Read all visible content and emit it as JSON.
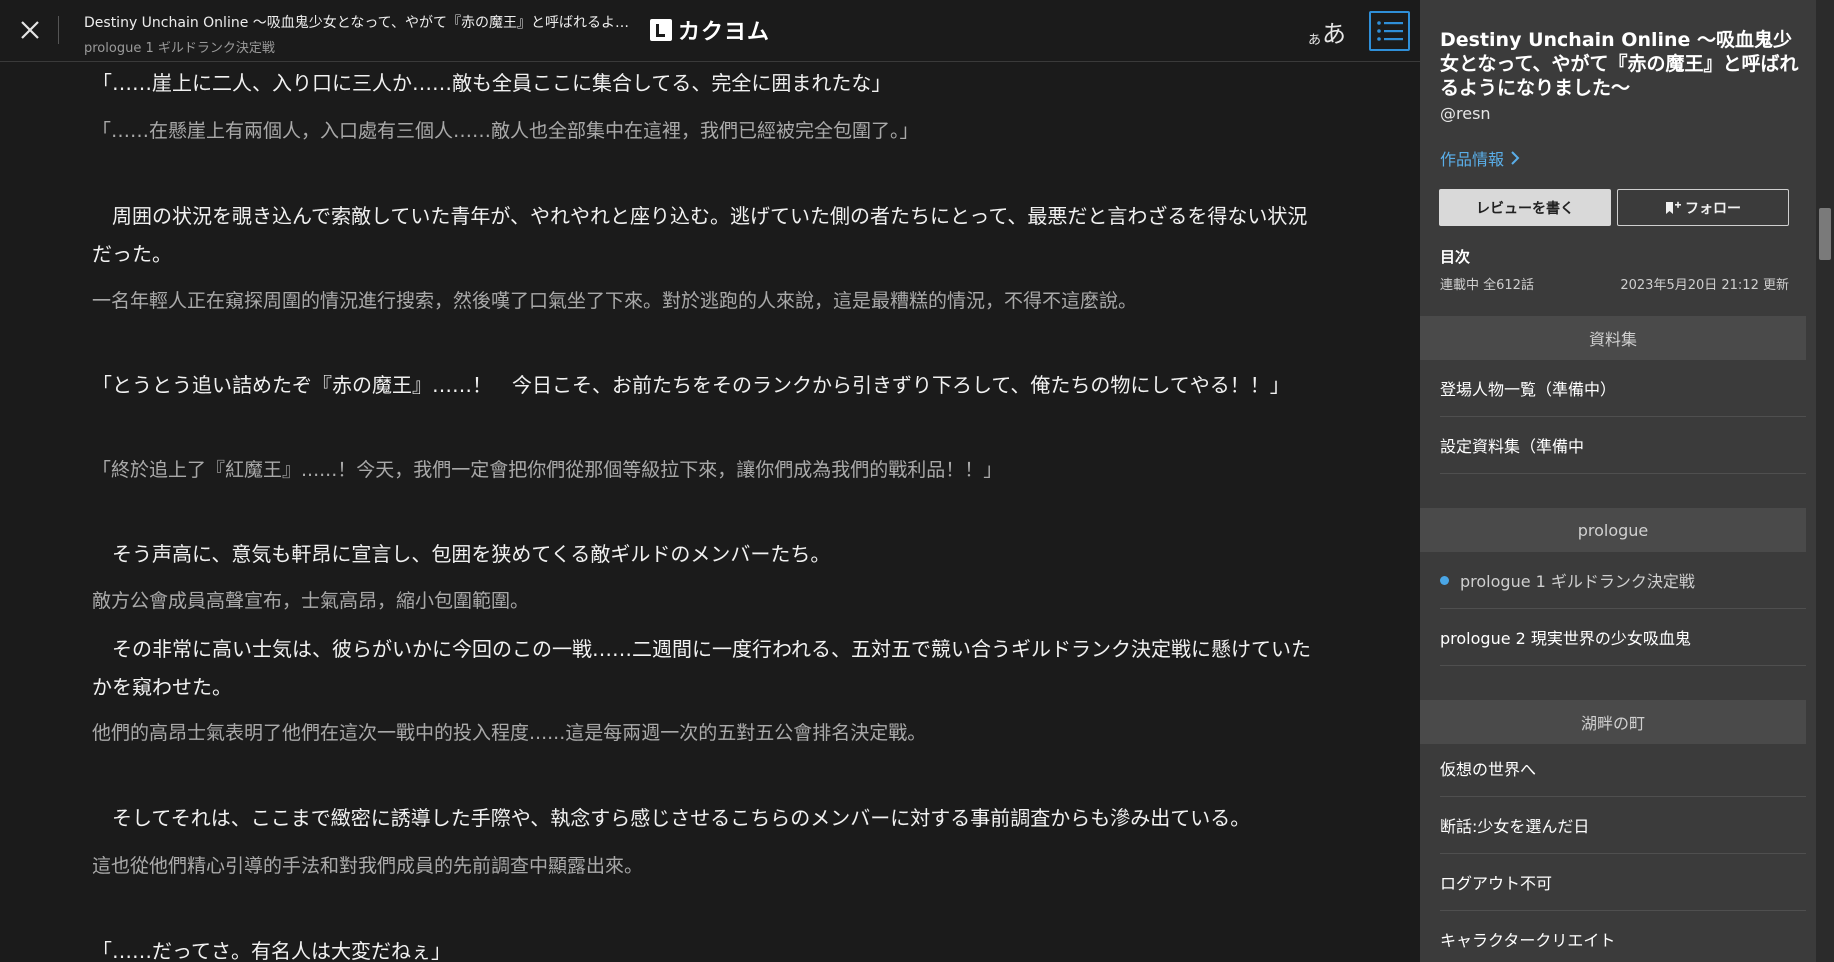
{
  "header": {
    "title": "Destiny Unchain Online 〜吸血鬼少女となって、やがて『赤の魔王』と呼ばれるよ…",
    "subtitle": "prologue 1 ギルドランク決定戦",
    "logo_text": "カクヨム",
    "font_small": "あ",
    "font_big": "あ"
  },
  "content": [
    {
      "kind": "para",
      "text": "「……崖上に二人、入り口に三人か……敵も全員ここに集合してる、完全に囲まれたな」"
    },
    {
      "kind": "trans",
      "text": "「……在懸崖上有兩個人，入口處有三個人……敵人也全部集中在這裡，我們已經被完全包圍了。」"
    },
    {
      "kind": "para",
      "text": "　周囲の状況を覗き込んで索敵していた青年が、やれやれと座り込む。逃げていた側の者たちにとって、最悪だと言わざるを得ない状況だった。"
    },
    {
      "kind": "trans",
      "text": "一名年輕人正在窺探周圍的情況進行搜索，然後嘆了口氣坐了下來。對於逃跑的人來說，這是最糟糕的情況，不得不這麼說。"
    },
    {
      "kind": "para",
      "text": "「とうとう追い詰めたぞ『赤の魔王』……！　今日こそ、お前たちをそのランクから引きずり下ろして、俺たちの物にしてやる！！」"
    },
    {
      "kind": "trans",
      "text": "「終於追上了『紅魔王』......！今天，我們一定會把你們從那個等級拉下來，讓你們成為我們的戰利品！！」"
    },
    {
      "kind": "para",
      "text": "　そう声高に、意気も軒昂に宣言し、包囲を狭めてくる敵ギルドのメンバーたち。"
    },
    {
      "kind": "trans",
      "text": "敵方公會成員高聲宣布，士氣高昂，縮小包圍範圍。"
    },
    {
      "kind": "para",
      "text": "　その非常に高い士気は、彼らがいかに今回のこの一戦……二週間に一度行われる、五対五で競い合うギルドランク決定戦に懸けていたかを窺わせた。"
    },
    {
      "kind": "trans",
      "text": "他們的高昂士氣表明了他們在這次一戰中的投入程度......這是每兩週一次的五對五公會排名決定戰。"
    },
    {
      "kind": "para",
      "text": "　そしてそれは、ここまで緻密に誘導した手際や、執念すら感じさせるこちらのメンバーに対する事前調査からも滲み出ている。"
    },
    {
      "kind": "trans",
      "text": "這也從他們精心引導的手法和對我們成員的先前調查中顯露出來。"
    },
    {
      "kind": "para",
      "text": "「……だってさ。有名人は大変だねぇ」"
    }
  ],
  "sidebar": {
    "title": "Destiny Unchain Online 〜吸血鬼少女となって、やがて『赤の魔王』と呼ばれるようになりました〜",
    "author": "@resn",
    "info_link": "作品情報",
    "review_button": "レビューを書く",
    "follow_button": "フォロー",
    "toc_label": "目次",
    "status": "連載中 全612話",
    "updated": "2023年5月20日 21:12 更新",
    "sections": [
      {
        "name": "資料集",
        "items": [
          "登場人物一覧（準備中）",
          "設定資料集（準備中"
        ]
      },
      {
        "name": "prologue",
        "items": [
          "prologue 1 ギルドランク決定戦",
          "prologue 2 現実世界の少女吸血鬼"
        ]
      },
      {
        "name": "湖畔の町",
        "items": [
          "仮想の世界へ",
          "断話:少女を選んだ日",
          "ログアウト不可",
          "キャラクタークリエイト"
        ]
      }
    ],
    "current_episode": "prologue 1 ギルドランク決定戦"
  },
  "colors": {
    "background": "#1b1b1b",
    "sidebar": "#3b3b3b",
    "accent": "#2f8fd8",
    "link": "#5aaee8"
  },
  "icons": [
    "close-icon",
    "toc-list-icon",
    "chevron-right-icon",
    "bookmark-plus-icon",
    "current-dot-icon"
  ]
}
